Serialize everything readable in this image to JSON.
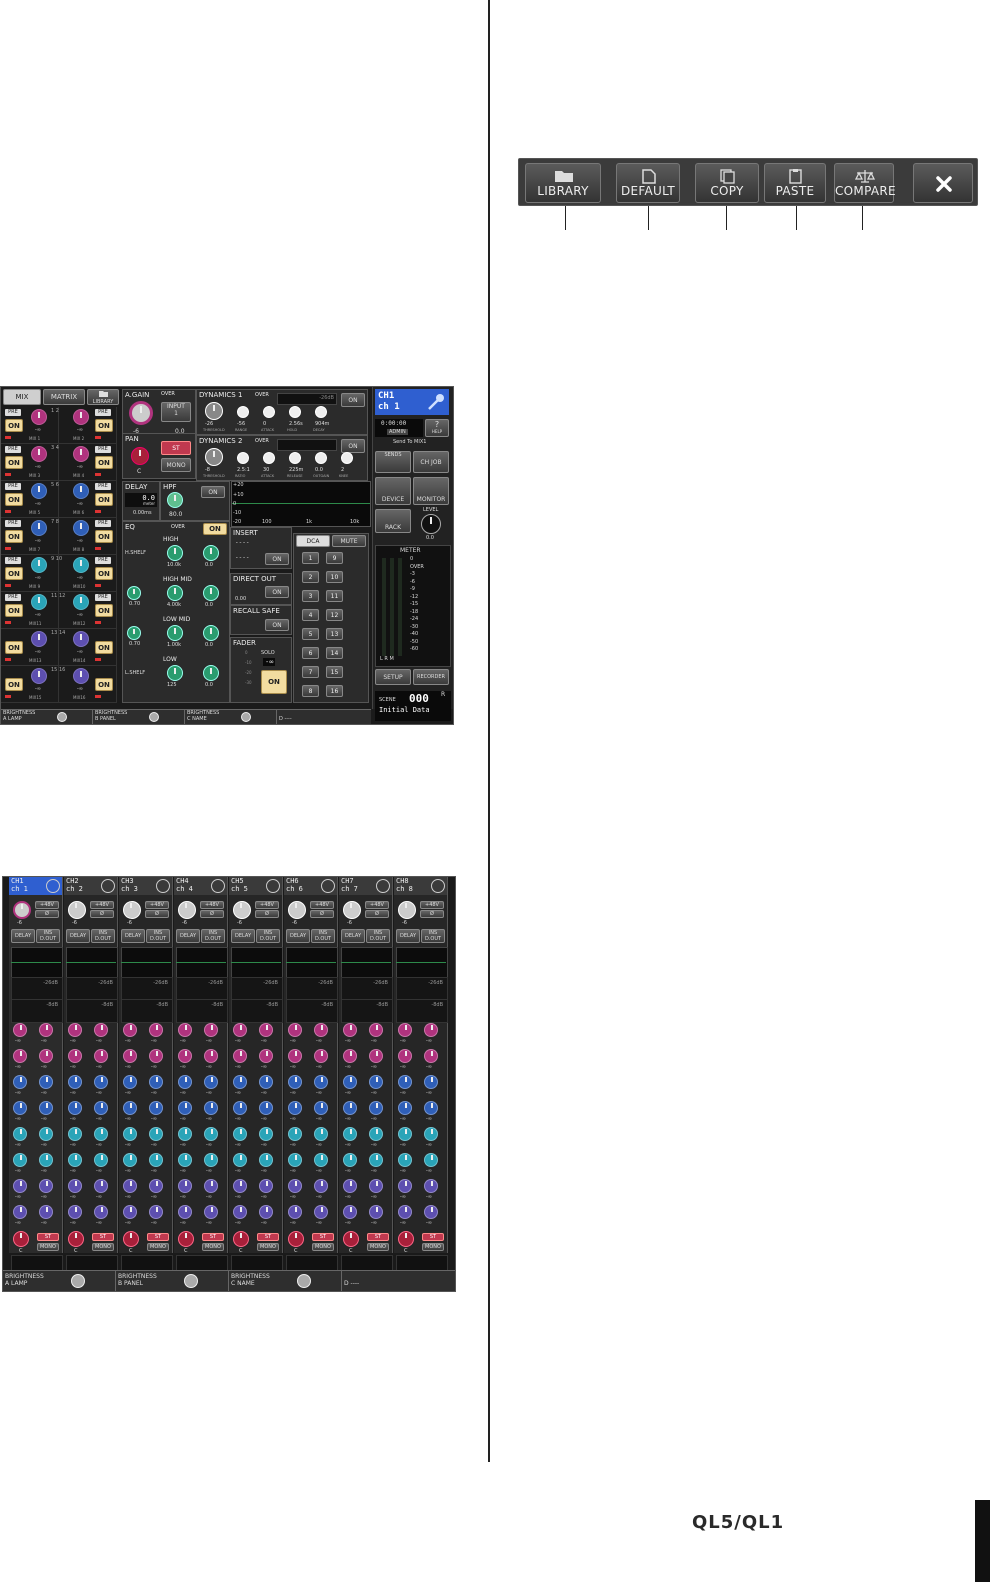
{
  "toolbar": {
    "buttons": [
      {
        "label": "LIBRARY",
        "icon": "folder-icon"
      },
      {
        "label": "DEFAULT",
        "icon": "document-icon"
      },
      {
        "label": "COPY",
        "icon": "copy-icon"
      },
      {
        "label": "PASTE",
        "icon": "paste-icon"
      },
      {
        "label": "COMPARE",
        "icon": "balance-scale-icon"
      }
    ],
    "close_icon": "close-icon"
  },
  "screen1": {
    "tabs": [
      "MIX",
      "MATRIX"
    ],
    "library_label": "LIBRARY",
    "on_label": "ON",
    "pre_label": "PRE",
    "inf_label": "-∞",
    "mix_labels": [
      "MIX 1",
      "MIX 2",
      "MIX 3",
      "MIX 4",
      "MIX 5",
      "MIX 6",
      "MIX 7",
      "MIX 8",
      "MIX 9",
      "MIX10",
      "MIX11",
      "MIX12",
      "MIX13",
      "MIX14",
      "MIX15",
      "MIX16"
    ],
    "pair_numbers": [
      "1 2",
      "3 4",
      "5 6",
      "7 8",
      "9 10",
      "11 12",
      "13 14",
      "15 16"
    ],
    "gain": {
      "title": "A.GAIN",
      "over": "OVER",
      "input": "INPUT",
      "input_num": "1",
      "value": "-6",
      "gain_value": "0.0"
    },
    "pan": {
      "title": "PAN",
      "st": "ST",
      "mono": "MONO",
      "value": "C"
    },
    "dynamics1": {
      "title": "DYNAMICS 1",
      "over": "OVER",
      "level": "-26dB",
      "on": "ON",
      "params": [
        {
          "v": "-26",
          "l": "THRESHOLD"
        },
        {
          "v": "-56",
          "l": "RANGE"
        },
        {
          "v": "0",
          "l": "ATTACK"
        },
        {
          "v": "2.56s",
          "l": "HOLD"
        },
        {
          "v": "904m",
          "l": "DECAY"
        }
      ]
    },
    "dynamics2": {
      "title": "DYNAMICS 2",
      "over": "OVER",
      "on": "ON",
      "params": [
        {
          "v": "-8",
          "l": "THRESHOLD"
        },
        {
          "v": "2.5:1",
          "l": "RATIO"
        },
        {
          "v": "30",
          "l": "ATTACK"
        },
        {
          "v": "225m",
          "l": "RELEASE"
        },
        {
          "v": "0.0",
          "l": "OUTGAIN"
        },
        {
          "v": "2",
          "l": "KNEE"
        }
      ]
    },
    "delay": {
      "title": "DELAY",
      "value": "0.0",
      "unit": "meter",
      "ms": "0.00ms"
    },
    "hpf": {
      "title": "HPF",
      "value": "80.0",
      "on": "ON"
    },
    "eq_graph": {
      "labels": [
        "+20",
        "+10",
        "0",
        "-10",
        "-20",
        "100",
        "1k",
        "10k"
      ]
    },
    "eq": {
      "title": "EQ",
      "over": "OVER",
      "on": "ON",
      "bands": [
        {
          "name": "HIGH",
          "type": "H.SHELF",
          "freq": "10.0k",
          "gain": "0.0",
          "q": ""
        },
        {
          "name": "HIGH MID",
          "type": "",
          "freq": "4.00k",
          "gain": "0.0",
          "q": "0.70"
        },
        {
          "name": "LOW MID",
          "type": "",
          "freq": "1.00k",
          "gain": "0.0",
          "q": "0.70"
        },
        {
          "name": "LOW",
          "type": "L.SHELF",
          "freq": "125",
          "gain": "0.0",
          "q": ""
        }
      ],
      "freq_label": "FREQUENCY",
      "gain_label": "GAIN",
      "q_label": "Q"
    },
    "insert": {
      "title": "INSERT",
      "v1": "----",
      "v2": "----",
      "on": "ON"
    },
    "direct_out": {
      "title": "DIRECT OUT",
      "value": "0.00",
      "on": "ON"
    },
    "recall_safe": {
      "title": "RECALL SAFE",
      "on": "ON"
    },
    "fader": {
      "title": "FADER",
      "solo": "SOLO",
      "value": "-∞",
      "on": "ON",
      "scale": [
        "0",
        "-10",
        "-20",
        "-30"
      ]
    },
    "dca_tabs": [
      "DCA",
      "MUTE"
    ],
    "dca_numbers": [
      "1",
      "9",
      "2",
      "10",
      "3",
      "11",
      "4",
      "12",
      "5",
      "13",
      "6",
      "14",
      "7",
      "15",
      "8",
      "16"
    ],
    "right": {
      "ch_line1": "CH1",
      "ch_line2": "ch  1",
      "time": "0:00:00",
      "user": "ADMIN",
      "help": "?",
      "help_label": "HELP",
      "send_to": "Send To MIX1",
      "sends": "SENDS",
      "ch_job": "CH JOB",
      "device": "DEVICE",
      "monitor": "MONITOR",
      "rack": "RACK",
      "level": "LEVEL",
      "level_val": "0.0",
      "meter_title": "METER",
      "meter_scale": [
        "0",
        "OVER",
        "-3",
        "-6",
        "-9",
        "-12",
        "-15",
        "-18",
        "-24",
        "-30",
        "-40",
        "-50",
        "-60"
      ],
      "meter_lrm": "L  R  M",
      "setup": "SETUP",
      "recorder": "RECORDER",
      "scene_label": "SCENE",
      "scene_num": "000",
      "scene_r": "R",
      "scene_name": "Initial Data"
    },
    "bottom": [
      {
        "letter": "A",
        "l1": "BRIGHTNESS",
        "l2": "LAMP"
      },
      {
        "letter": "B",
        "l1": "BRIGHTNESS",
        "l2": "PANEL"
      },
      {
        "letter": "C",
        "l1": "BRIGHTNESS",
        "l2": "NAME"
      },
      {
        "letter": "D",
        "l1": "",
        "l2": "----"
      }
    ]
  },
  "screen2": {
    "strips": [
      {
        "id": "CH1",
        "name": "ch 1"
      },
      {
        "id": "CH2",
        "name": "ch 2"
      },
      {
        "id": "CH3",
        "name": "ch 3"
      },
      {
        "id": "CH4",
        "name": "ch 4"
      },
      {
        "id": "CH5",
        "name": "ch 5"
      },
      {
        "id": "CH6",
        "name": "ch 6"
      },
      {
        "id": "CH7",
        "name": "ch 7"
      },
      {
        "id": "CH8",
        "name": "ch 8"
      }
    ],
    "gain_value": "-6",
    "phantom": "+48V",
    "phase": "Ø",
    "delay": "DELAY",
    "ins": "INS",
    "d_out": "D.OUT",
    "dyn_level": "-26dB",
    "dyn2_level": "-8dB",
    "inf": "-∞",
    "st": "ST",
    "mono": "MONO",
    "pan": "C",
    "bottom": [
      {
        "letter": "A",
        "l1": "BRIGHTNESS",
        "l2": "LAMP"
      },
      {
        "letter": "B",
        "l1": "BRIGHTNESS",
        "l2": "PANEL"
      },
      {
        "letter": "C",
        "l1": "BRIGHTNESS",
        "l2": "NAME"
      },
      {
        "letter": "D",
        "l1": "",
        "l2": "----"
      }
    ]
  },
  "footer": {
    "brand": "QL5/QL1"
  },
  "colors": {
    "magenta": "#b0337e",
    "blue": "#2f5fb8",
    "cyan": "#2aa4b8",
    "violet": "#5d4fb0",
    "red": "#a8203a",
    "on_yellow": "#f2dca0",
    "select_blue": "#2f5fd0"
  }
}
